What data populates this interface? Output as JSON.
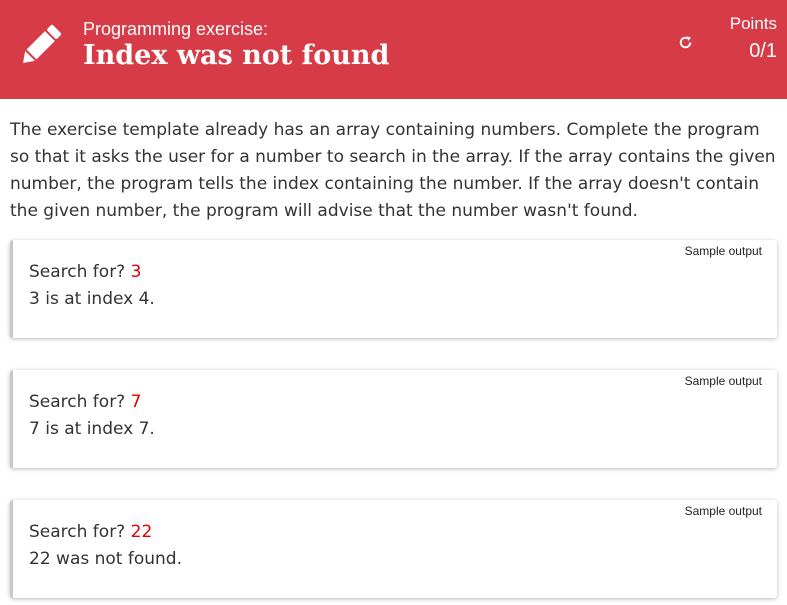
{
  "header": {
    "subtitle": "Programming exercise:",
    "title": "Index was not found",
    "points_label": "Points",
    "points_value": "0/1",
    "background_color": "#d63b47",
    "icons": [
      "pencil-icon",
      "refresh-icon"
    ]
  },
  "description": "The exercise template already has an array containing numbers. Complete the program so that it asks the user for a number to search in the array. If the array contains the given number, the program tells the index containing the number. If the array doesn't contain the given number, the program will advise that the number wasn't found.",
  "samples": [
    {
      "label": "Sample output",
      "prompt": "Search for? ",
      "input": "3",
      "result": "3 is at index 4."
    },
    {
      "label": "Sample output",
      "prompt": "Search for? ",
      "input": "7",
      "result": "7 is at index 7."
    },
    {
      "label": "Sample output",
      "prompt": "Search for? ",
      "input": "22",
      "result": "22 was not found."
    }
  ],
  "colors": {
    "accent": "#d63b47",
    "user_input": "#e00000"
  }
}
